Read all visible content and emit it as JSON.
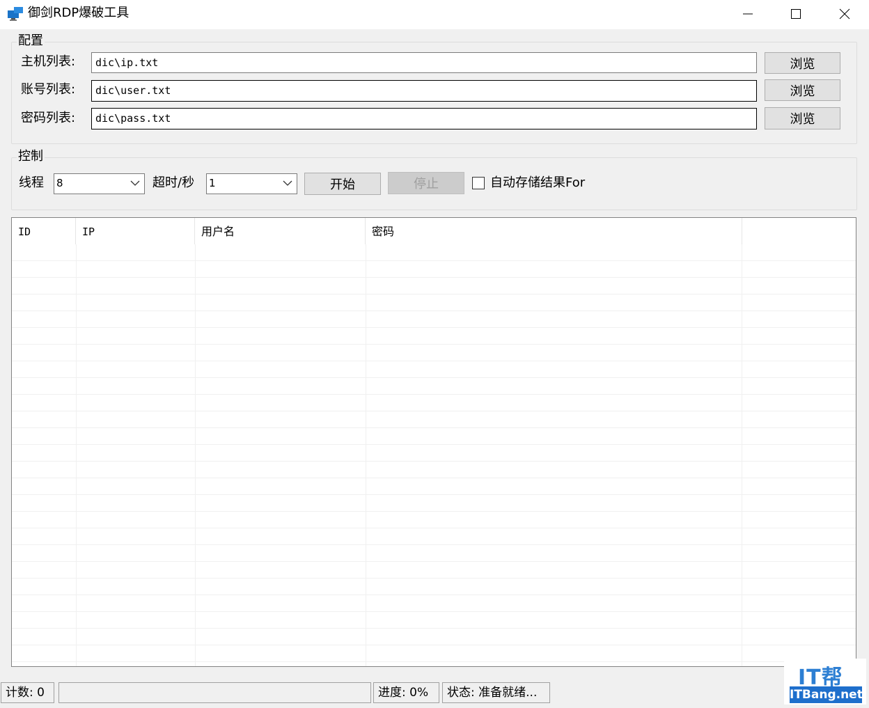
{
  "window": {
    "title": "御剑RDP爆破工具"
  },
  "config": {
    "legend": "配置",
    "rows": [
      {
        "label": "主机列表:",
        "value": "dic\\ip.txt",
        "button": "浏览"
      },
      {
        "label": "账号列表:",
        "value": "dic\\user.txt",
        "button": "浏览"
      },
      {
        "label": "密码列表:",
        "value": "dic\\pass.txt",
        "button": "浏览"
      }
    ]
  },
  "control": {
    "legend": "控制",
    "threads_label": "线程",
    "threads_value": "8",
    "timeout_label": "超时/秒",
    "timeout_value": "1",
    "start_label": "开始",
    "stop_label": "停止",
    "autosave_label": "自动存储结果For",
    "autosave_checked": false
  },
  "results": {
    "columns": [
      "ID",
      "IP",
      "用户名",
      "密码"
    ],
    "rows": []
  },
  "statusbar": {
    "count": "计数: 0",
    "progress": "进度: 0%",
    "progress_value": 0,
    "status": "状态: 准备就绪..."
  },
  "watermark": {
    "top": "IT帮",
    "bottom": "ITBang.net"
  }
}
